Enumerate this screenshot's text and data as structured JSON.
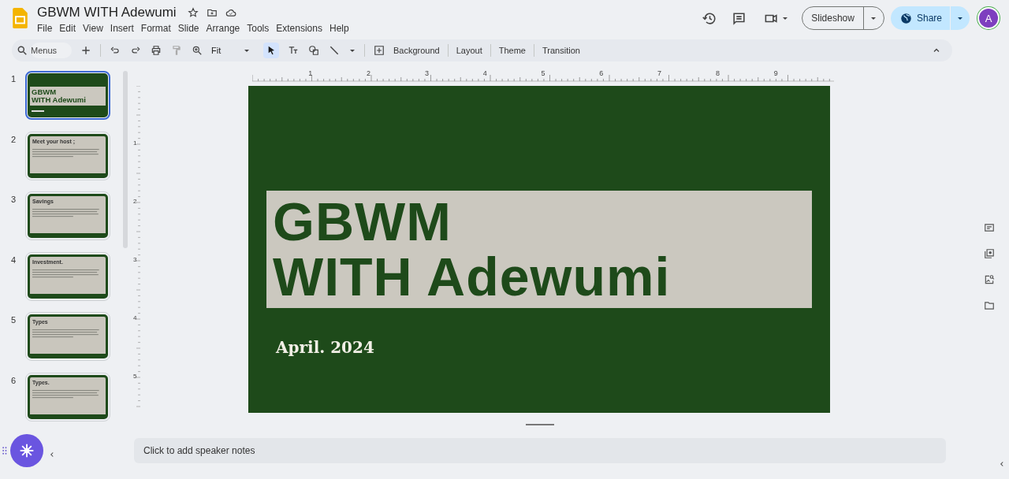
{
  "document": {
    "title": "GBWM WITH Adewumi"
  },
  "menu": [
    "File",
    "Edit",
    "View",
    "Insert",
    "Format",
    "Slide",
    "Arrange",
    "Tools",
    "Extensions",
    "Help"
  ],
  "header": {
    "slideshow": "Slideshow",
    "share": "Share",
    "avatar": "A"
  },
  "toolbar": {
    "search_placeholder": "Menus",
    "zoom": "Fit",
    "buttons": [
      "Background",
      "Layout",
      "Theme",
      "Transition"
    ]
  },
  "ruler": {
    "horizontal": [
      "1",
      "2",
      "3",
      "4",
      "5",
      "6",
      "7",
      "8",
      "9"
    ],
    "vertical": [
      "1",
      "2",
      "3",
      "4",
      "5"
    ]
  },
  "slides": [
    {
      "number": "1",
      "kind": "title",
      "selected": true,
      "title_lines": [
        "GBWM",
        "WITH Adewumi"
      ]
    },
    {
      "number": "2",
      "kind": "content",
      "selected": false,
      "title": "Meet your host ;"
    },
    {
      "number": "3",
      "kind": "content",
      "selected": false,
      "title": "Savings"
    },
    {
      "number": "4",
      "kind": "content",
      "selected": false,
      "title": "Investment."
    },
    {
      "number": "5",
      "kind": "content",
      "selected": false,
      "title": "Types"
    },
    {
      "number": "6",
      "kind": "content",
      "selected": false,
      "title": "Types."
    }
  ],
  "current_slide": {
    "title_lines": [
      "GBWM",
      "WITH Adewumi"
    ],
    "date": "April. 2024"
  },
  "notes": {
    "placeholder": "Click to add speaker notes"
  }
}
